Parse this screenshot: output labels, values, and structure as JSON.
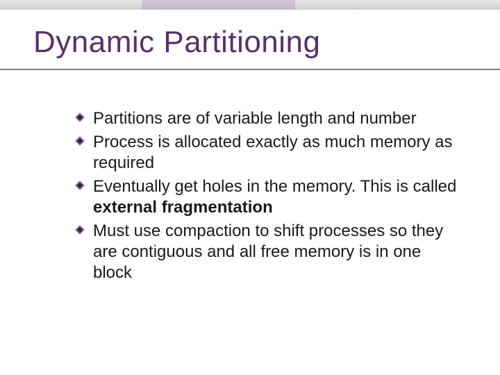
{
  "title": "Dynamic Partitioning",
  "bullets": [
    {
      "text": "Partitions are of variable length and number"
    },
    {
      "text": "Process is allocated exactly as much memory as required"
    },
    {
      "pre": "Eventually get holes in the memory. This is called ",
      "bold": "external fragmentation"
    },
    {
      "text": "Must use compaction to shift processes so they are contiguous and all free memory is in one block"
    }
  ]
}
